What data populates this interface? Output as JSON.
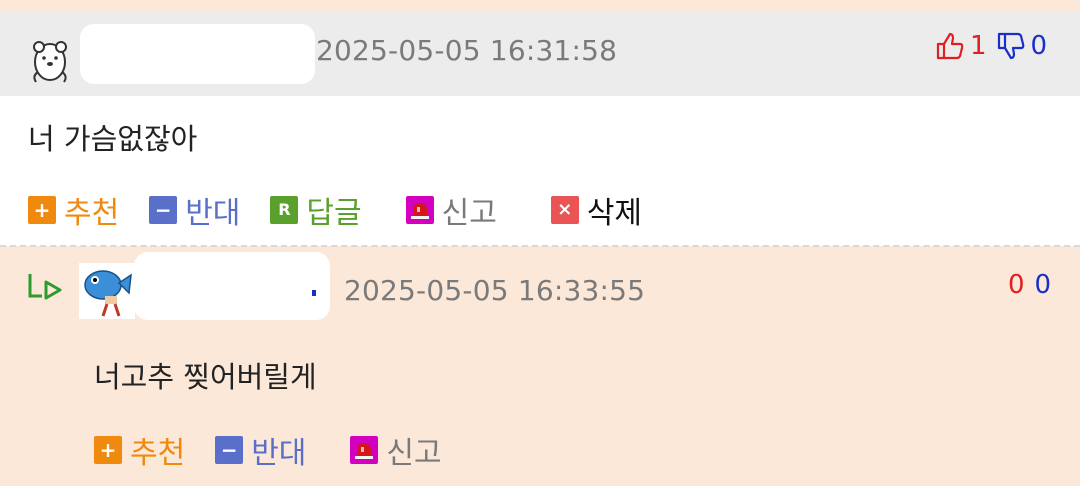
{
  "comments": [
    {
      "timestamp": "2025-05-05 16:31:58",
      "up_count": "1",
      "down_count": "0",
      "text": "너 가슴없잖아",
      "actions": {
        "recommend": "추천",
        "oppose": "반대",
        "reply": "답글",
        "report": "신고",
        "delete": "삭제"
      }
    },
    {
      "timestamp": "2025-05-05 16:33:55",
      "up_count": "0",
      "down_count": "0",
      "text": "너고추 찢어버릴게",
      "actions": {
        "recommend": "추천",
        "oppose": "반대",
        "report": "신고"
      }
    }
  ],
  "colors": {
    "recommend": "#ef8a0f",
    "oppose": "#5a6fc9",
    "reply": "#5aa02c",
    "report": "#d400c0",
    "delete": "#ea5454",
    "up": "#e02020",
    "down": "#1a2fc8",
    "reply_arrow": "#2f9a2f"
  },
  "icons": [
    "avatar-bear-icon",
    "thumbs-up-icon",
    "thumbs-down-icon",
    "plus-icon",
    "minus-icon",
    "reply-r-icon",
    "siren-icon",
    "delete-x-icon",
    "reply-arrow-icon",
    "avatar-fish-icon"
  ]
}
